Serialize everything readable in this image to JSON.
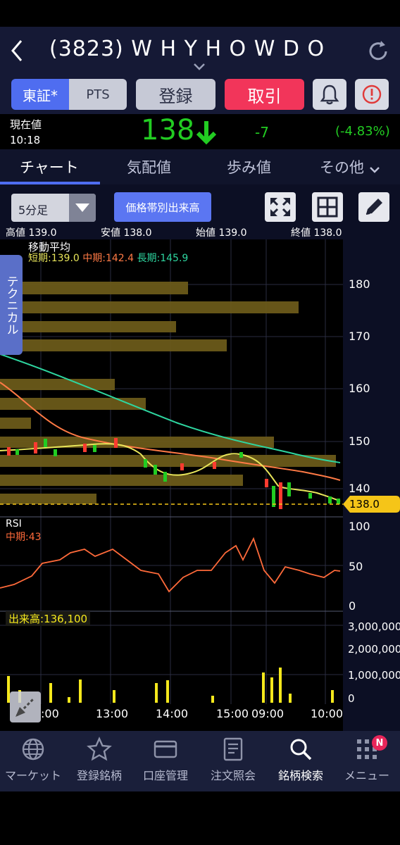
{
  "header": {
    "title": "(3823) W H Y  H O W  D O"
  },
  "toolbar": {
    "tse": "東証*",
    "pts": "PTS",
    "register": "登録",
    "trade": "取引"
  },
  "price": {
    "current_label": "現在値",
    "time": "10:18",
    "value": "138",
    "change": "-7",
    "change_pct": "(-4.83%)",
    "up_color": "#1ec41e"
  },
  "tabs": [
    "チャート",
    "気配値",
    "歩み値",
    "その他"
  ],
  "chart_controls": {
    "interval": "5分足",
    "volume_profile": "価格帯別出来高"
  },
  "ohlc": {
    "high_label": "高値",
    "high": "139.0",
    "low_label": "安値",
    "low": "138.0",
    "open_label": "始値",
    "open": "139.0",
    "close_label": "終値",
    "close": "138.0"
  },
  "ma": {
    "title": "移動平均",
    "short": "短期:139.0",
    "mid": "中期:142.4",
    "long": "長期:145.9"
  },
  "technical_tab": "テクニカル",
  "rsi": {
    "title": "RSI",
    "mid": "中期:43"
  },
  "volume": {
    "title": "出来高:136,100"
  },
  "price_axis": [
    "180",
    "170",
    "160",
    "150",
    "140"
  ],
  "price_tag": "138.0",
  "rsi_axis": [
    "100",
    "50",
    "0"
  ],
  "vol_axis": [
    "3,000,000",
    "2,000,000",
    "1,000,000",
    "0"
  ],
  "time_axis": [
    ":00",
    "13:00",
    "14:00",
    "15:00",
    "09:00",
    "10:00"
  ],
  "nav": [
    "マーケット",
    "登録銘柄",
    "口座管理",
    "注文照会",
    "銘柄検索",
    "メニュー"
  ],
  "nav_badge": "N",
  "colors": {
    "accent": "#4f6df0",
    "trade": "#f2355a",
    "down": "#ff3b30",
    "up": "#22cc22",
    "ma_short": "#e8e55a",
    "ma_mid": "#ff7a45",
    "ma_long": "#2ed6a0",
    "profile": "#6b5a1a"
  }
}
